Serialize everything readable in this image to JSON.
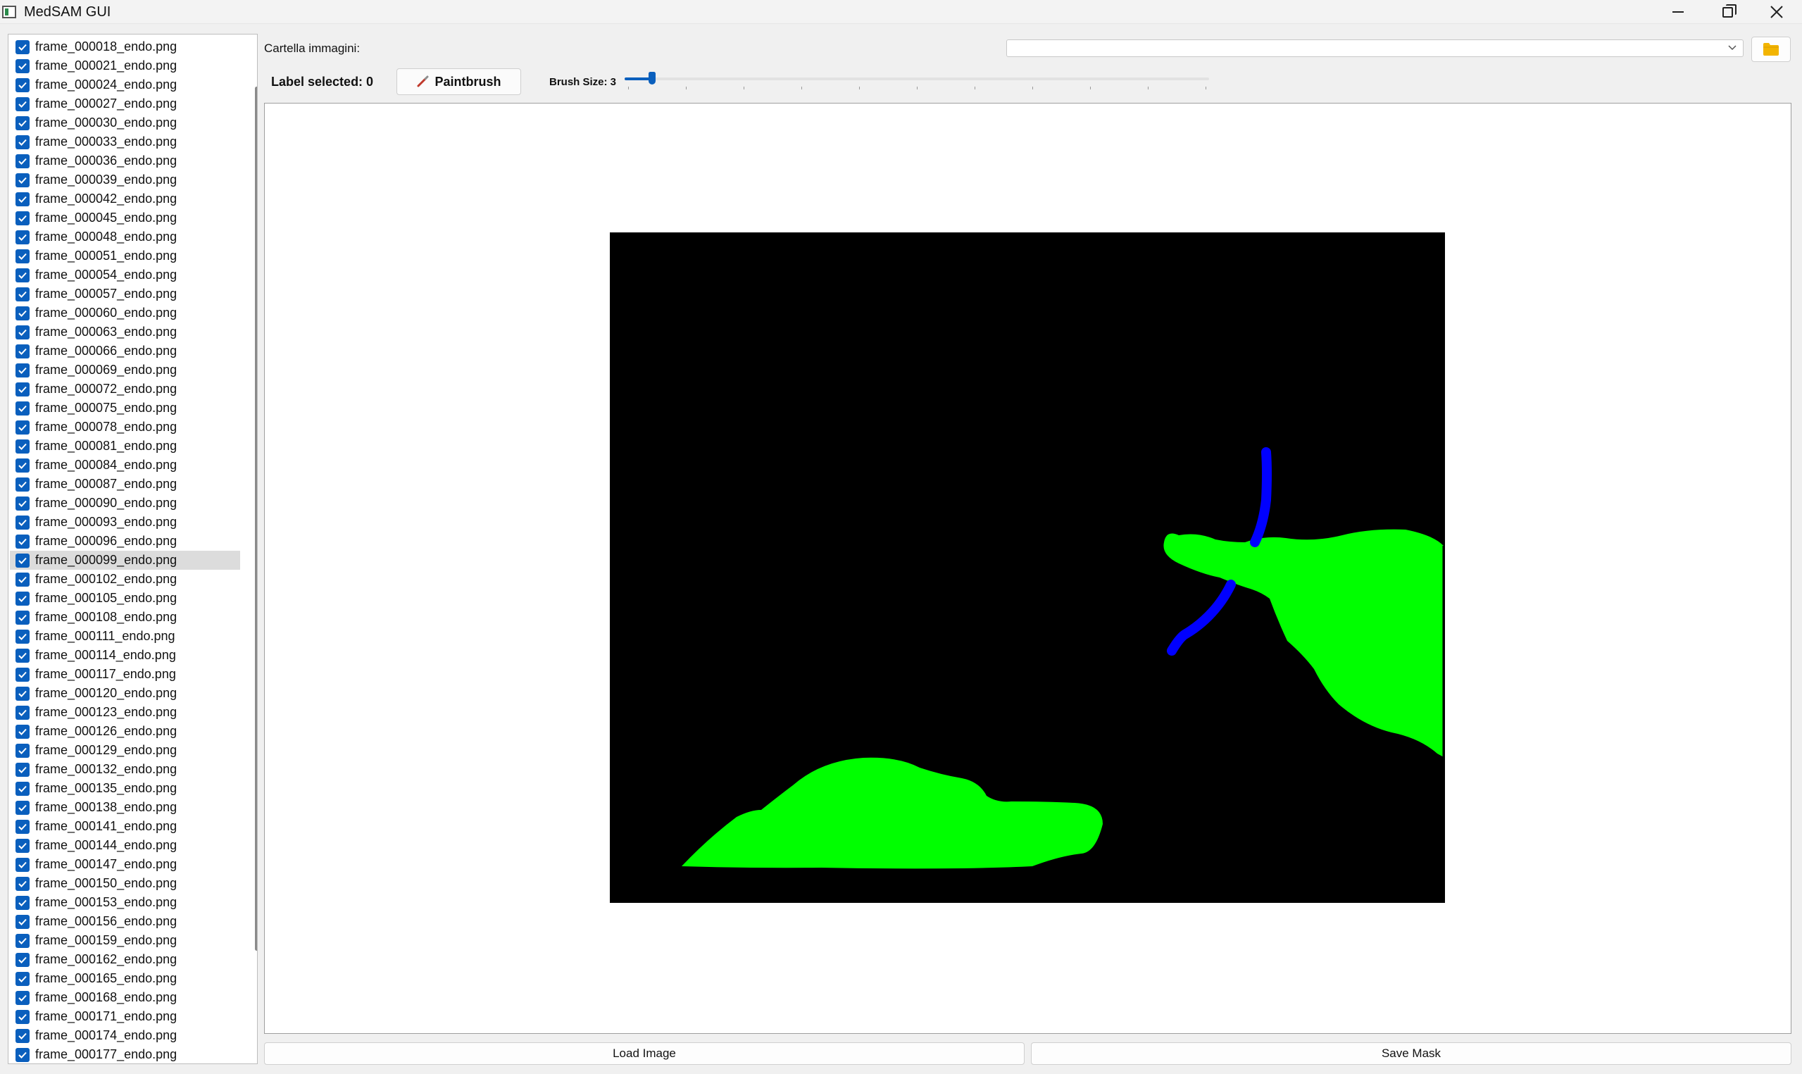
{
  "window": {
    "title": "MedSAM GUI"
  },
  "file_list": {
    "items": [
      {
        "name": "frame_000018_endo.png",
        "checked": true
      },
      {
        "name": "frame_000021_endo.png",
        "checked": true
      },
      {
        "name": "frame_000024_endo.png",
        "checked": true
      },
      {
        "name": "frame_000027_endo.png",
        "checked": true
      },
      {
        "name": "frame_000030_endo.png",
        "checked": true
      },
      {
        "name": "frame_000033_endo.png",
        "checked": true
      },
      {
        "name": "frame_000036_endo.png",
        "checked": true
      },
      {
        "name": "frame_000039_endo.png",
        "checked": true
      },
      {
        "name": "frame_000042_endo.png",
        "checked": true
      },
      {
        "name": "frame_000045_endo.png",
        "checked": true
      },
      {
        "name": "frame_000048_endo.png",
        "checked": true
      },
      {
        "name": "frame_000051_endo.png",
        "checked": true
      },
      {
        "name": "frame_000054_endo.png",
        "checked": true
      },
      {
        "name": "frame_000057_endo.png",
        "checked": true
      },
      {
        "name": "frame_000060_endo.png",
        "checked": true
      },
      {
        "name": "frame_000063_endo.png",
        "checked": true
      },
      {
        "name": "frame_000066_endo.png",
        "checked": true
      },
      {
        "name": "frame_000069_endo.png",
        "checked": true
      },
      {
        "name": "frame_000072_endo.png",
        "checked": true
      },
      {
        "name": "frame_000075_endo.png",
        "checked": true
      },
      {
        "name": "frame_000078_endo.png",
        "checked": true
      },
      {
        "name": "frame_000081_endo.png",
        "checked": true
      },
      {
        "name": "frame_000084_endo.png",
        "checked": true
      },
      {
        "name": "frame_000087_endo.png",
        "checked": true
      },
      {
        "name": "frame_000090_endo.png",
        "checked": true
      },
      {
        "name": "frame_000093_endo.png",
        "checked": true
      },
      {
        "name": "frame_000096_endo.png",
        "checked": true
      },
      {
        "name": "frame_000099_endo.png",
        "checked": true,
        "selected": true
      },
      {
        "name": "frame_000102_endo.png",
        "checked": true
      },
      {
        "name": "frame_000105_endo.png",
        "checked": true
      },
      {
        "name": "frame_000108_endo.png",
        "checked": true
      },
      {
        "name": "frame_000111_endo.png",
        "checked": true
      },
      {
        "name": "frame_000114_endo.png",
        "checked": true
      },
      {
        "name": "frame_000117_endo.png",
        "checked": true
      },
      {
        "name": "frame_000120_endo.png",
        "checked": true
      },
      {
        "name": "frame_000123_endo.png",
        "checked": true
      },
      {
        "name": "frame_000126_endo.png",
        "checked": true
      },
      {
        "name": "frame_000129_endo.png",
        "checked": true
      },
      {
        "name": "frame_000132_endo.png",
        "checked": true
      },
      {
        "name": "frame_000135_endo.png",
        "checked": true
      },
      {
        "name": "frame_000138_endo.png",
        "checked": true
      },
      {
        "name": "frame_000141_endo.png",
        "checked": true
      },
      {
        "name": "frame_000144_endo.png",
        "checked": true
      },
      {
        "name": "frame_000147_endo.png",
        "checked": true
      },
      {
        "name": "frame_000150_endo.png",
        "checked": true
      },
      {
        "name": "frame_000153_endo.png",
        "checked": true
      },
      {
        "name": "frame_000156_endo.png",
        "checked": true
      },
      {
        "name": "frame_000159_endo.png",
        "checked": true
      },
      {
        "name": "frame_000162_endo.png",
        "checked": true
      },
      {
        "name": "frame_000165_endo.png",
        "checked": true
      },
      {
        "name": "frame_000168_endo.png",
        "checked": true
      },
      {
        "name": "frame_000171_endo.png",
        "checked": true
      },
      {
        "name": "frame_000174_endo.png",
        "checked": true
      },
      {
        "name": "frame_000177_endo.png",
        "checked": true
      }
    ]
  },
  "toolbar": {
    "folder_label": "Cartella immagini:",
    "folder_value": "",
    "label_selected": "Label selected: 0",
    "paintbrush_label": "Paintbrush",
    "brush_size_label": "Brush Size: 3",
    "brush_size": 3,
    "brush_size_min": 1,
    "brush_size_max": 100
  },
  "canvas": {
    "mask_colors": {
      "background": "#000000",
      "label_green": "#00ff00",
      "label_blue": "#0000ff"
    }
  },
  "actions": {
    "load_label": "Load Image",
    "save_label": "Save Mask"
  },
  "colors": {
    "accent": "#0a5fbd",
    "folder_icon": "#f2b400",
    "selected_row": "#dcdcdc"
  }
}
